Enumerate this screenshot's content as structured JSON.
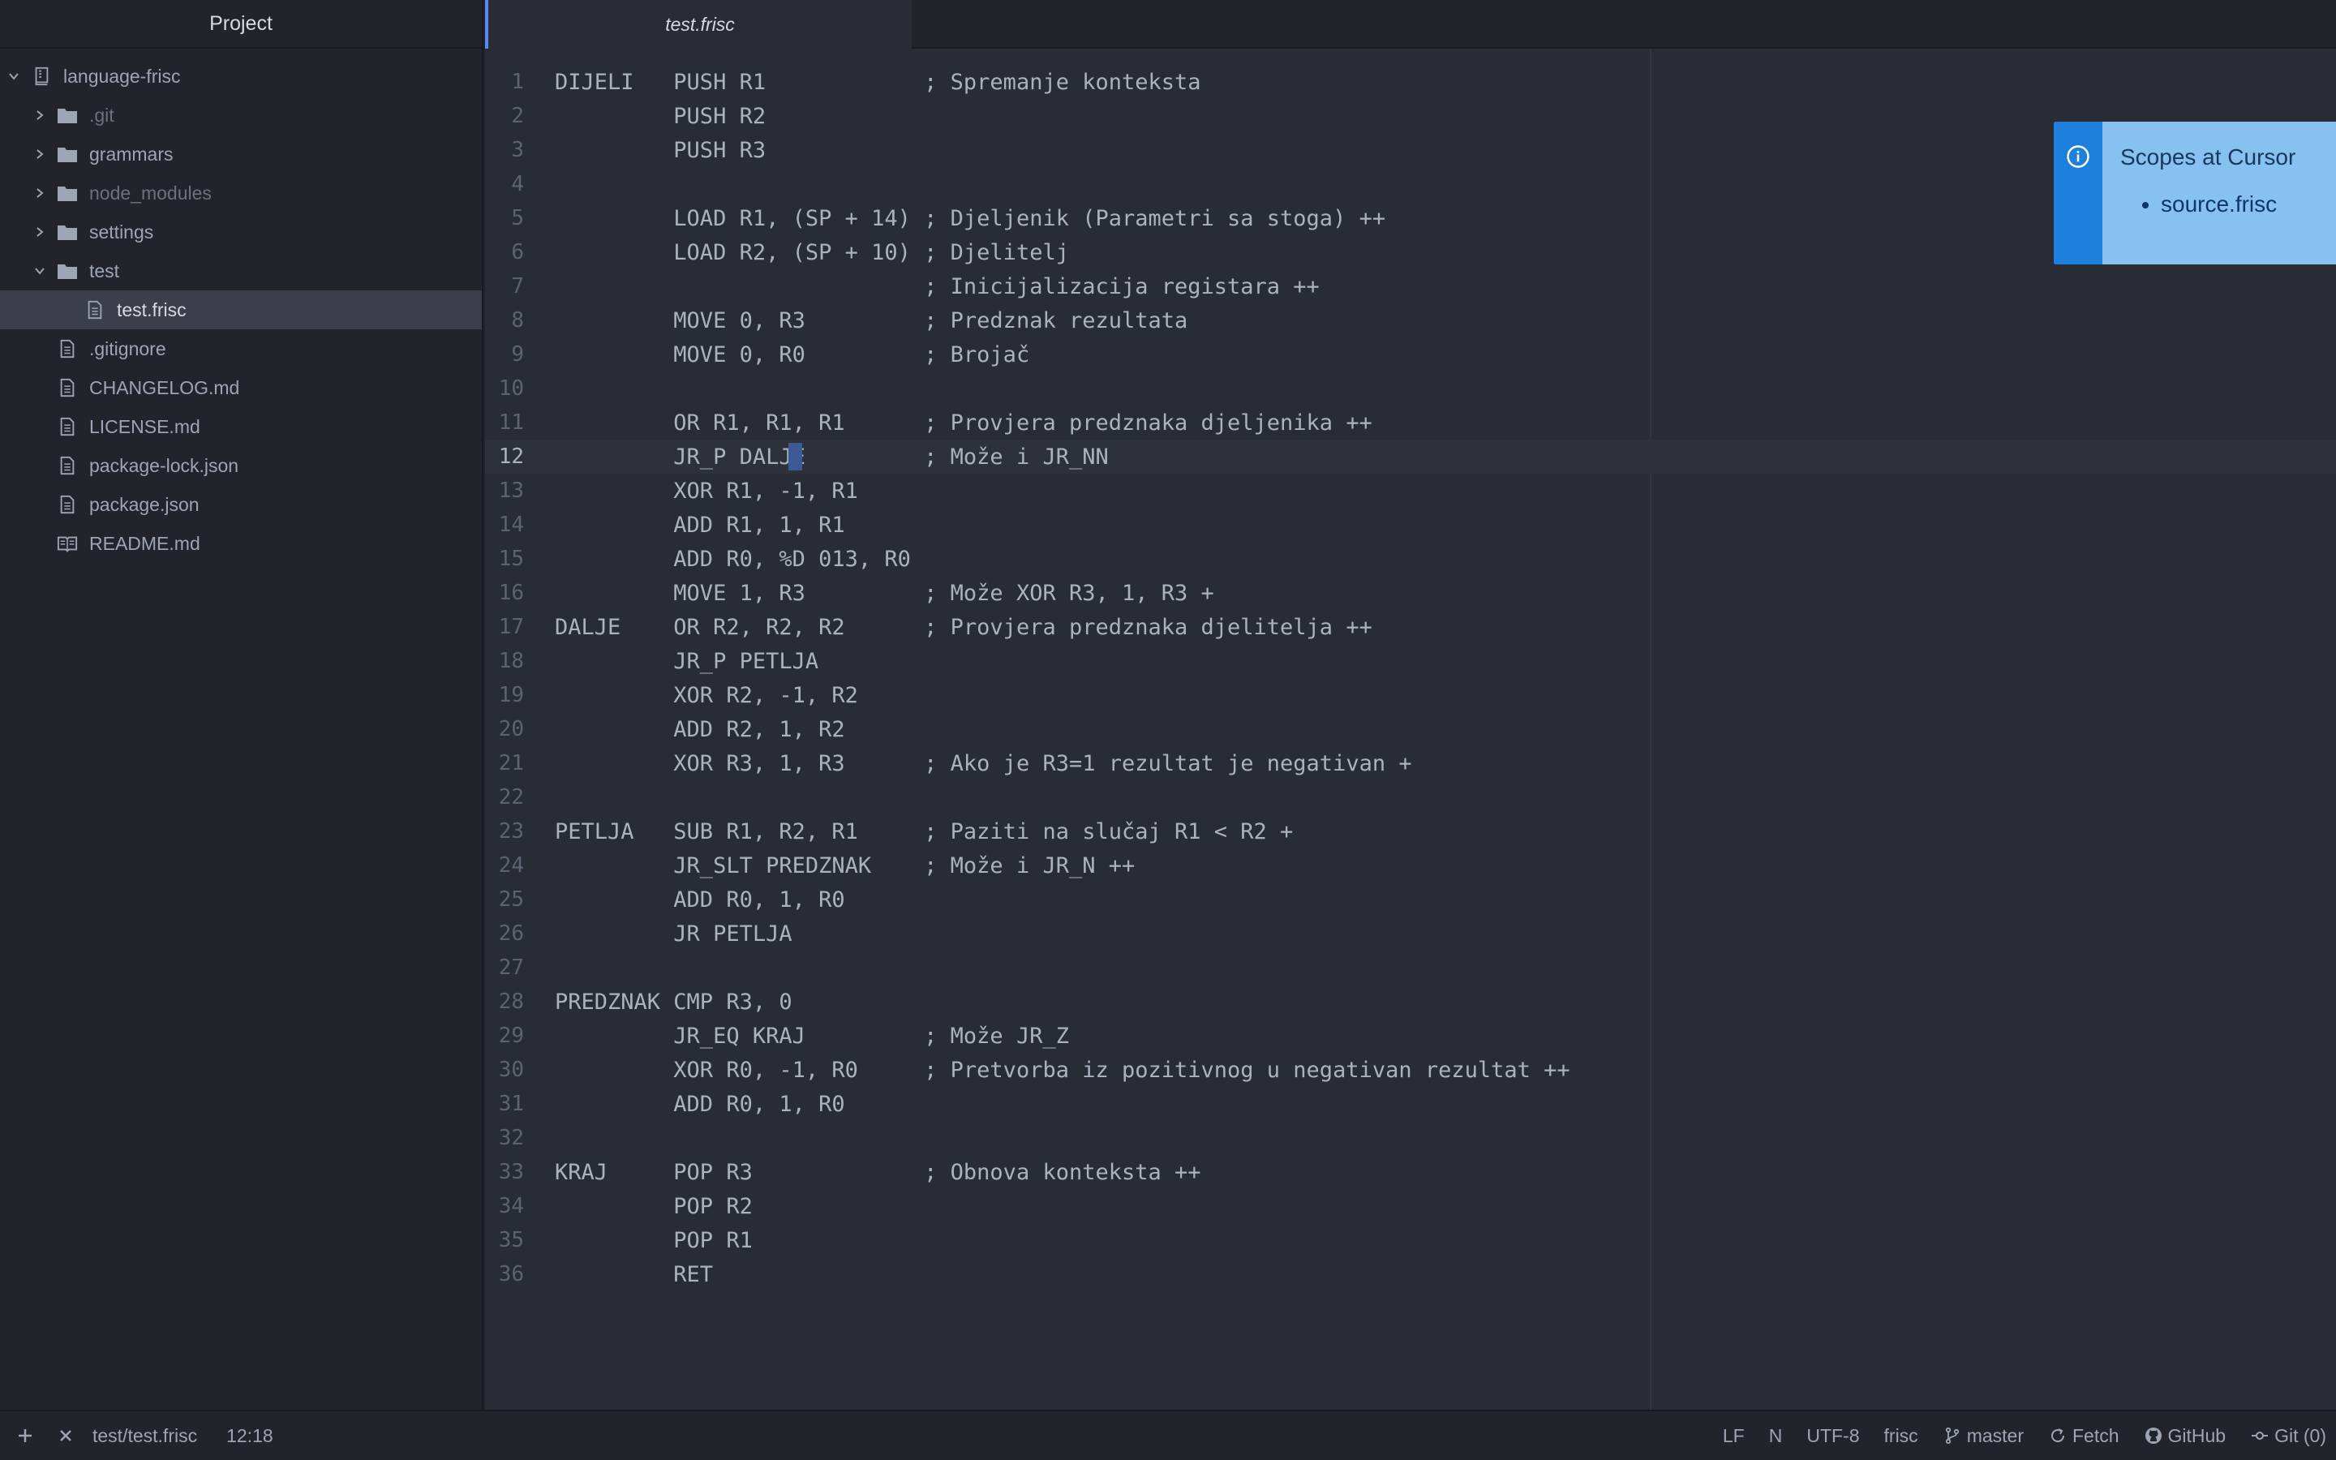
{
  "sidebar": {
    "title": "Project",
    "items": [
      {
        "label": "language-frisc",
        "type": "repo",
        "indent": 0,
        "chevron": "down"
      },
      {
        "label": ".git",
        "type": "folder",
        "indent": 1,
        "chevron": "right",
        "dim": true
      },
      {
        "label": "grammars",
        "type": "folder",
        "indent": 1,
        "chevron": "right"
      },
      {
        "label": "node_modules",
        "type": "folder",
        "indent": 1,
        "chevron": "right",
        "dim": true
      },
      {
        "label": "settings",
        "type": "folder",
        "indent": 1,
        "chevron": "right"
      },
      {
        "label": "test",
        "type": "folder",
        "indent": 1,
        "chevron": "down"
      },
      {
        "label": "test.frisc",
        "type": "file",
        "indent": 2,
        "selected": true
      },
      {
        "label": ".gitignore",
        "type": "file",
        "indent": 1
      },
      {
        "label": "CHANGELOG.md",
        "type": "file",
        "indent": 1
      },
      {
        "label": "LICENSE.md",
        "type": "file",
        "indent": 1
      },
      {
        "label": "package-lock.json",
        "type": "file",
        "indent": 1
      },
      {
        "label": "package.json",
        "type": "file",
        "indent": 1
      },
      {
        "label": "README.md",
        "type": "book",
        "indent": 1
      }
    ]
  },
  "tabs": [
    {
      "label": "test.frisc",
      "active": true
    }
  ],
  "editor": {
    "cursor_line": 12,
    "lines": [
      "DIJELI   PUSH R1            ; Spremanje konteksta",
      "         PUSH R2",
      "         PUSH R3",
      "",
      "         LOAD R1, (SP + 14) ; Djeljenik (Parametri sa stoga) ++",
      "         LOAD R2, (SP + 10) ; Djelitelj",
      "                            ; Inicijalizacija registara ++",
      "         MOVE 0, R3         ; Predznak rezultata",
      "         MOVE 0, R0         ; Brojač",
      "",
      "         OR R1, R1, R1      ; Provjera predznaka djeljenika ++",
      "         JR_P DALJE         ; Može i JR_NN",
      "         XOR R1, -1, R1",
      "         ADD R1, 1, R1",
      "         ADD R0, %D 013, R0",
      "         MOVE 1, R3         ; Može XOR R3, 1, R3 +",
      "DALJE    OR R2, R2, R2      ; Provjera predznaka djelitelja ++",
      "         JR_P PETLJA",
      "         XOR R2, -1, R2",
      "         ADD R2, 1, R2",
      "         XOR R3, 1, R3      ; Ako je R3=1 rezultat je negativan +",
      "",
      "PETLJA   SUB R1, R2, R1     ; Paziti na slučaj R1 < R2 +",
      "         JR_SLT PREDZNAK    ; Može i JR_N ++",
      "         ADD R0, 1, R0",
      "         JR PETLJA",
      "",
      "PREDZNAK CMP R3, 0",
      "         JR_EQ KRAJ         ; Može JR_Z",
      "         XOR R0, -1, R0     ; Pretvorba iz pozitivnog u negativan rezultat ++",
      "         ADD R0, 1, R0",
      "",
      "KRAJ     POP R3             ; Obnova konteksta ++",
      "         POP R2",
      "         POP R1",
      "         RET"
    ]
  },
  "notification": {
    "title": "Scopes at Cursor",
    "items": [
      "source.frisc"
    ],
    "icon": "info-icon",
    "accent": "#1c80dc",
    "background": "#86c1ef"
  },
  "statusbar": {
    "file_path": "test/test.frisc",
    "cursor_position": "12:18",
    "line_ending": "LF",
    "indent_mode": "N",
    "encoding": "UTF-8",
    "grammar": "frisc",
    "branch": "master",
    "fetch_label": "Fetch",
    "github_label": "GitHub",
    "git_label": "Git (0)"
  }
}
